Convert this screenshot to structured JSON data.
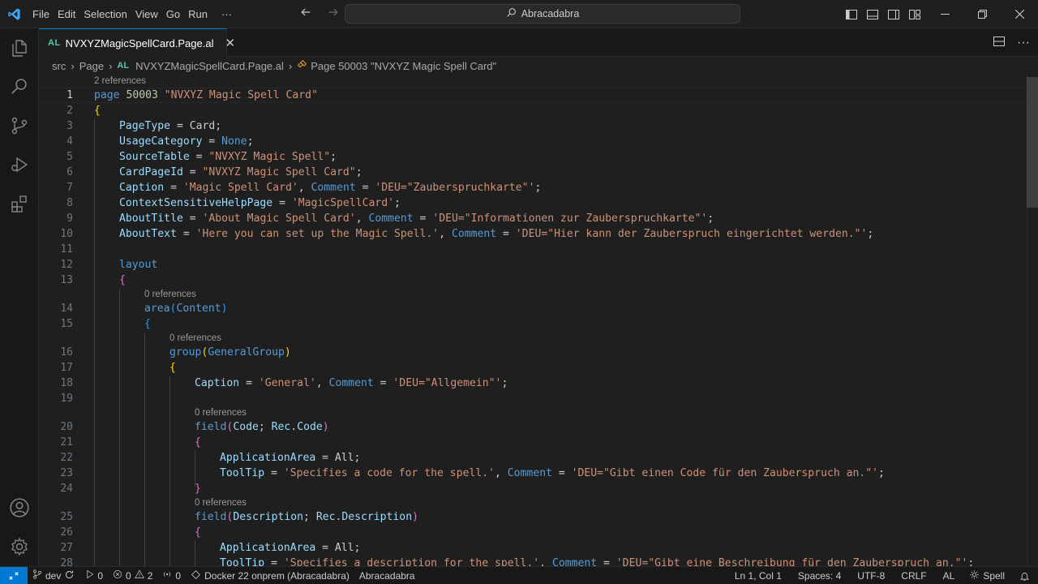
{
  "titlebar": {
    "menu": [
      "File",
      "Edit",
      "Selection",
      "View",
      "Go",
      "Run",
      "···"
    ],
    "search_text": "Abracadabra"
  },
  "tab": {
    "badge": "AL",
    "label": "NVXYZMagicSpellCard.Page.al",
    "close": "✕"
  },
  "breadcrumb": {
    "items": [
      "src",
      "Page",
      "NVXYZMagicSpellCard.Page.al",
      "Page 50003 \"NVXYZ Magic Spell Card\""
    ],
    "al_badge": "AL"
  },
  "editor": {
    "codelens": {
      "refs2": "2 references",
      "refs0": "0 references"
    },
    "lines": [
      {
        "n": "1"
      },
      {
        "n": "2"
      },
      {
        "n": "3"
      },
      {
        "n": "4"
      },
      {
        "n": "5"
      },
      {
        "n": "6"
      },
      {
        "n": "7"
      },
      {
        "n": "8"
      },
      {
        "n": "9"
      },
      {
        "n": "10"
      },
      {
        "n": "11"
      },
      {
        "n": "12"
      },
      {
        "n": "13"
      },
      {
        "n": "14"
      },
      {
        "n": "15"
      },
      {
        "n": "16"
      },
      {
        "n": "17"
      },
      {
        "n": "18"
      },
      {
        "n": "19"
      },
      {
        "n": "20"
      },
      {
        "n": "21"
      },
      {
        "n": "22"
      },
      {
        "n": "23"
      },
      {
        "n": "24"
      },
      {
        "n": "25"
      },
      {
        "n": "26"
      },
      {
        "n": "27"
      },
      {
        "n": "28"
      }
    ],
    "code": {
      "l1_kw": "page",
      "l1_num": "50003",
      "l1_str": "\"NVXYZ Magic Spell Card\"",
      "open_brace": "{",
      "close_brace": "}",
      "l3_prop": "PageType",
      "l3_rest": " = Card;",
      "l4_prop": "UsageCategory",
      "l4_eq": " = ",
      "l4_val": "None",
      "semi": ";",
      "l5_prop": "SourceTable",
      "l5_eq": " = ",
      "l5_str": "\"NVXYZ Magic Spell\"",
      "l6_prop": "CardPageId",
      "l6_eq": " = ",
      "l6_str": "\"NVXYZ Magic Spell Card\"",
      "l7_prop": "Caption",
      "l7_eq": " = ",
      "l7_str": "'Magic Spell Card'",
      "comma": ", ",
      "comment_kw": "Comment",
      "l7_cstr": "'DEU=\"Zauberspruchkarte\"'",
      "l8_prop": "ContextSensitiveHelpPage",
      "l8_eq": " = ",
      "l8_str": "'MagicSpellCard'",
      "l9_prop": "AboutTitle",
      "l9_eq": " = ",
      "l9_str": "'About Magic Spell Card'",
      "l9_cstr": "'DEU=\"Informationen zur Zauberspruchkarte\"'",
      "l10_prop": "AboutText",
      "l10_eq": " = ",
      "l10_str": "'Here you can set up the Magic Spell.'",
      "l10_cstr": "'DEU=\"Hier kann der Zauberspruch eingerichtet werden.\"'",
      "l12_kw": "layout",
      "l14_fn": "area",
      "l14_arg": "Content",
      "l16_fn": "group",
      "l16_arg": "GeneralGroup",
      "l18_prop": "Caption",
      "l18_eq": " = ",
      "l18_str": "'General'",
      "l18_cstr": "'DEU=\"Allgemein\"'",
      "l20_fn": "field",
      "l20_a1": "Code",
      "l20_sep": "; ",
      "l20_rec": "Rec",
      "l20_dot": ".",
      "l20_a2": "Code",
      "l22_prop": "ApplicationArea",
      "l22_rest": " = All;",
      "l23_prop": "ToolTip",
      "l23_eq": " = ",
      "l23_str": "'Specifies a code for the spell.'",
      "l23_cstr": "'DEU=\"Gibt einen Code für den Zauberspruch an.\"'",
      "l25_fn": "field",
      "l25_a1": "Description",
      "l25_rec": "Rec",
      "l25_a2": "Description",
      "l27_prop": "ApplicationArea",
      "l27_rest": " = All;",
      "l28_prop": "ToolTip",
      "l28_eq": " = ",
      "l28_str": "'Specifies a description for the spell.'",
      "l28_cstr": "'DEU=\"Gibt eine Beschreibung für den Zauberspruch an.\"'",
      "eq_sp": " = ",
      "paren_open": "(",
      "paren_close": ")"
    }
  },
  "statusbar": {
    "branch": "dev",
    "sync": "0",
    "errors": "0",
    "warnings": "2",
    "ports": "0",
    "docker": "Docker 22 onprem (Abracadabra)",
    "workspace": "Abracadabra",
    "position": "Ln 1, Col 1",
    "spaces": "Spaces: 4",
    "encoding": "UTF-8",
    "eol": "CRLF",
    "language": "AL",
    "spell": "Spell"
  },
  "colors": {
    "accent": "#0078d4",
    "keyword": "#569cd6",
    "string": "#ce9178",
    "property": "#9cdcfe",
    "bracket1": "#ffd700",
    "bracket2": "#da70d6",
    "bracket3": "#179fff"
  }
}
